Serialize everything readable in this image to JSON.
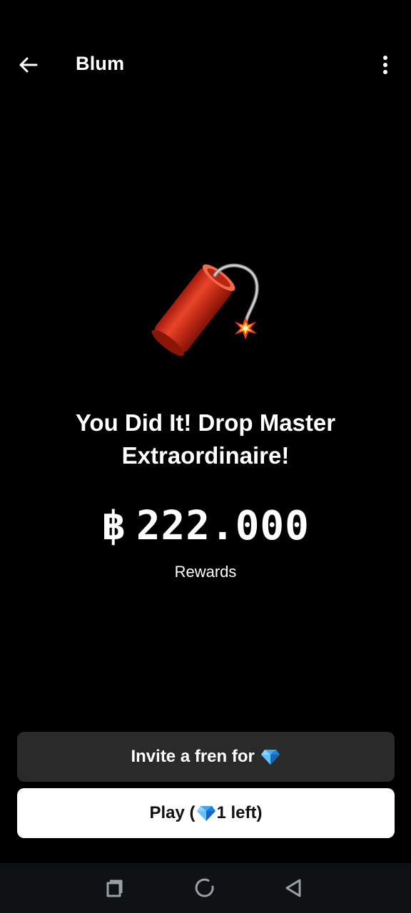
{
  "header": {
    "title": "Blum",
    "back_icon": "arrow-left-icon",
    "menu_icon": "more-vertical-icon"
  },
  "hero": {
    "icon": "firecracker-icon",
    "headline": "You Did It! Drop Master Extraordinaire!"
  },
  "reward": {
    "currency_symbol": "฿",
    "amount": "222.000",
    "label": "Rewards"
  },
  "buttons": {
    "invite_label": "Invite a fren for",
    "play_prefix": "Play (",
    "play_suffix": "1 left)",
    "gem_icon": "gem-icon"
  },
  "navbar": {
    "recents_icon": "square-icon",
    "home_icon": "circle-icon",
    "back_icon": "triangle-back-icon"
  },
  "colors": {
    "background": "#000000",
    "invite_button": "#2a2a2a",
    "play_button": "#ffffff",
    "navbar": "#0f1214"
  }
}
